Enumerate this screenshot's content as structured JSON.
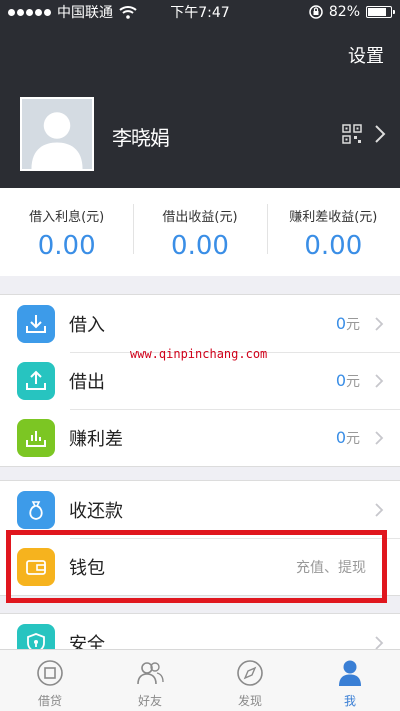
{
  "status_bar": {
    "carrier": "中国联通",
    "time": "下午7:47",
    "battery": "82%",
    "battery_level": 0.82
  },
  "header": {
    "settings_label": "设置",
    "username": "李晓娟"
  },
  "stats": [
    {
      "label": "借入利息(元)",
      "value": "0.00"
    },
    {
      "label": "借出收益(元)",
      "value": "0.00"
    },
    {
      "label": "赚利差收益(元)",
      "value": "0.00"
    }
  ],
  "menu_group_1": [
    {
      "label": "借入",
      "value": "0",
      "unit": "元",
      "icon": "download-tray-icon",
      "color": "#3d9be9"
    },
    {
      "label": "借出",
      "value": "0",
      "unit": "元",
      "icon": "upload-tray-icon",
      "color": "#27c4c0"
    },
    {
      "label": "赚利差",
      "value": "0",
      "unit": "元",
      "icon": "chart-tray-icon",
      "color": "#7cc623"
    }
  ],
  "menu_group_2": [
    {
      "label": "收还款",
      "icon": "money-bag-icon",
      "color": "#3d9be9"
    },
    {
      "label": "钱包",
      "hint": "充值、提现",
      "icon": "wallet-icon",
      "color": "#f6b31e"
    }
  ],
  "menu_group_3": [
    {
      "label": "安全",
      "icon": "shield-icon",
      "color": "#27c4c0"
    }
  ],
  "watermark": "www.qinpinchang.com",
  "tabs": [
    {
      "label": "借贷",
      "icon": "loan-icon",
      "active": false
    },
    {
      "label": "好友",
      "icon": "friends-icon",
      "active": false
    },
    {
      "label": "发现",
      "icon": "compass-icon",
      "active": false
    },
    {
      "label": "我",
      "icon": "person-icon",
      "active": true
    }
  ],
  "colors": {
    "header_bg": "#2b2d33",
    "accent_blue": "#3a8ee6",
    "highlight_red": "#e0161e"
  }
}
